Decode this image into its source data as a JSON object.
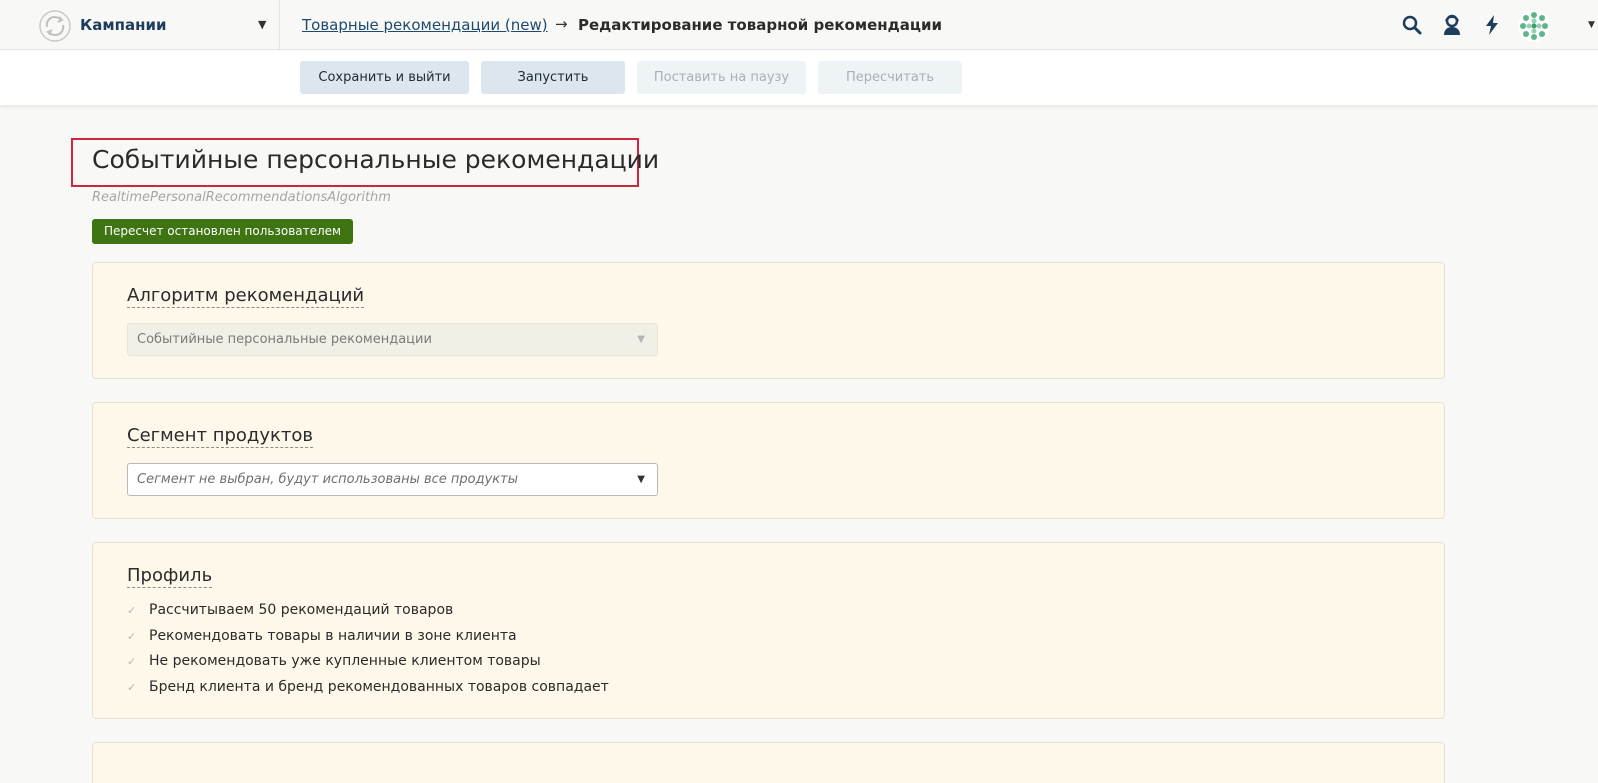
{
  "topbar": {
    "module_label": "Кампании",
    "breadcrumb_link": "Товарные рекомендации (new)",
    "breadcrumb_separator": "→",
    "breadcrumb_current": "Редактирование товарной рекомендации",
    "icons": [
      "sync-logo-icon",
      "search-icon",
      "support-agent-icon",
      "lightning-icon",
      "avatar"
    ]
  },
  "toolbar": {
    "save_exit": "Сохранить и выйти",
    "launch": "Запустить",
    "pause": "Поставить на паузу",
    "recalculate": "Пересчитать"
  },
  "page": {
    "title": "Событийные персональные рекомендации",
    "subtitle": "RealtimePersonalRecommendationsAlgorithm",
    "status": "Пересчет остановлен пользователем",
    "status_color": "#3f7412",
    "highlight_color": "#d0263d"
  },
  "algorithm": {
    "title": "Алгоритм рекомендаций",
    "value": "Событийные персональные рекомендации"
  },
  "segment": {
    "title": "Сегмент продуктов",
    "value": "Сегмент не выбран, будут использованы все продукты"
  },
  "profile": {
    "title": "Профиль",
    "items": [
      "Рассчитываем 50 рекомендаций товаров",
      "Рекомендовать товары в наличии в зоне клиента",
      "Не рекомендовать уже купленные клиентом товары",
      "Бренд клиента и бренд рекомендованных товаров совпадает"
    ]
  }
}
